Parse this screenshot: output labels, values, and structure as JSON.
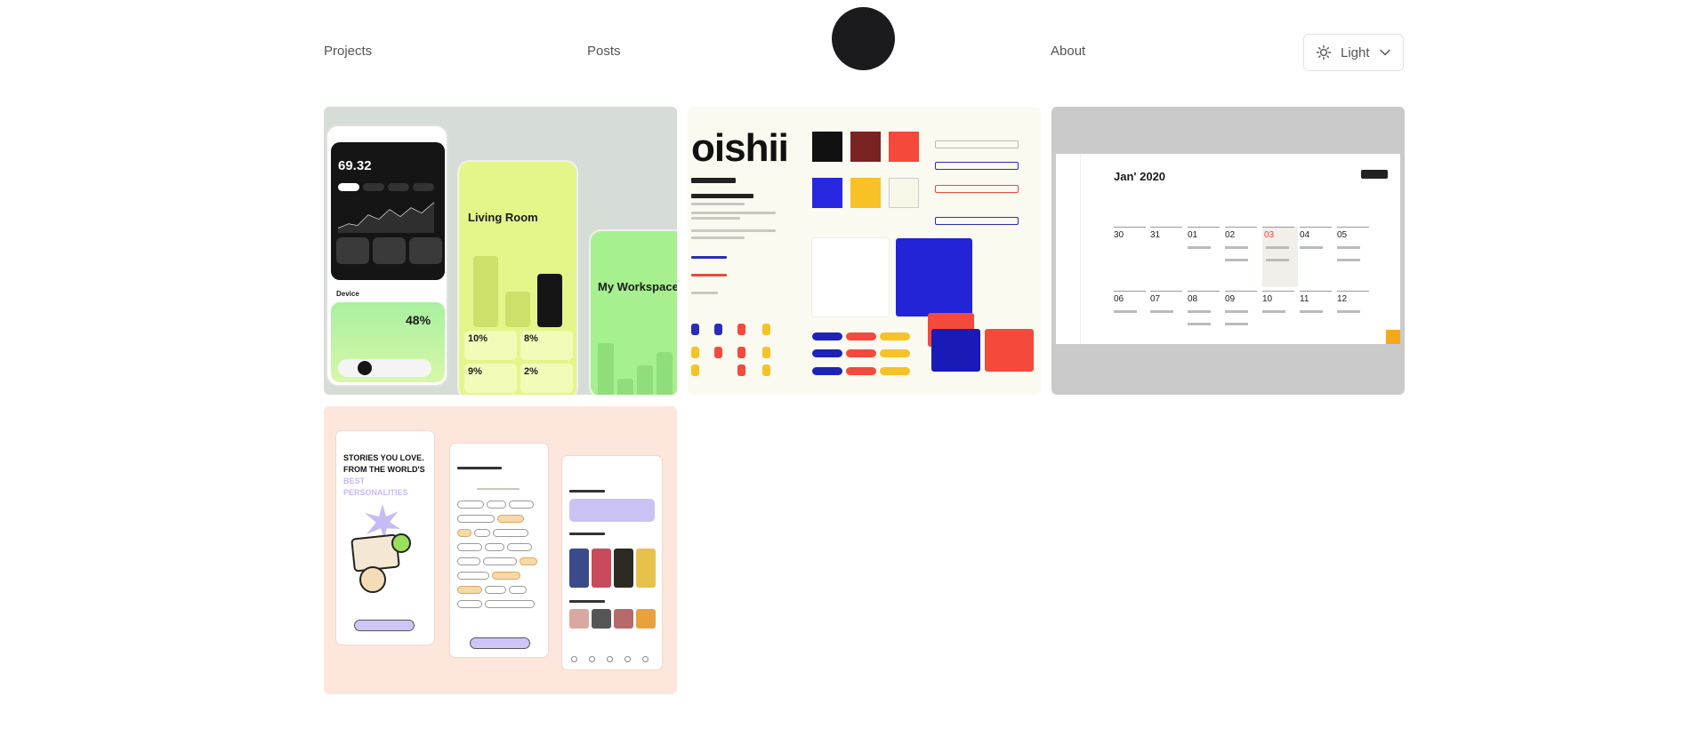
{
  "nav": {
    "projects": "Projects",
    "posts": "Posts",
    "about": "About"
  },
  "theme": {
    "label": "Light",
    "icon": "sun-icon"
  },
  "colors": {
    "logo": "#1b1a1c",
    "card1_bg": "#d6ddd6",
    "card2_bg": "#fafaf0",
    "card3_bg": "#cacaca",
    "card4_bg": "#fde6dc"
  },
  "projects": [
    {
      "phone1_value": "69.32",
      "phone1_percent": "48%",
      "phone1_section": "Device",
      "phone2_title": "Living Room",
      "phone2_stats": [
        "10%",
        "8%",
        "9%",
        "2%"
      ],
      "phone3_title": "My Workspace"
    },
    {
      "brand": "oishii"
    },
    {
      "calendar_title": "Jan' 2020",
      "week1": [
        "30",
        "31",
        "01",
        "02",
        "03",
        "04",
        "05"
      ],
      "week2": [
        "06",
        "07",
        "08",
        "09",
        "10",
        "11",
        "12"
      ]
    },
    {
      "headline_1": "STORIES YOU LOVE.",
      "headline_2": "FROM THE WORLD'S",
      "headline_3": "BEST",
      "headline_4": "PERSONALITIES"
    }
  ]
}
